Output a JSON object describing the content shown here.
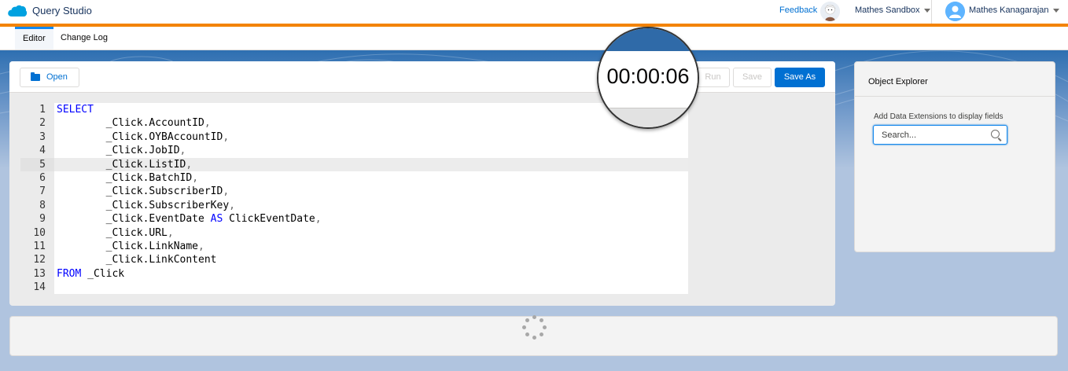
{
  "header": {
    "app_title": "Query Studio",
    "feedback_label": "Feedback",
    "org_name": "Mathes Sandbox",
    "user_name": "Mathes Kanagarajan",
    "accent_color": "#f38303",
    "logo_icon": "salesforce-cloud-icon"
  },
  "tabs": [
    {
      "label": "Editor",
      "active": true
    },
    {
      "label": "Change Log",
      "active": false
    }
  ],
  "toolbar": {
    "open_label": "Open",
    "run_label": "Run",
    "save_label": "Save",
    "save_as_label": "Save As",
    "timer": "00:00:06"
  },
  "editor": {
    "current_line": 5,
    "lines": [
      {
        "n": "1",
        "text": "SELECT"
      },
      {
        "n": "2",
        "text": "        _Click.AccountID,"
      },
      {
        "n": "3",
        "text": "        _Click.OYBAccountID,"
      },
      {
        "n": "4",
        "text": "        _Click.JobID,"
      },
      {
        "n": "5",
        "text": "        _Click.ListID,"
      },
      {
        "n": "6",
        "text": "        _Click.BatchID,"
      },
      {
        "n": "7",
        "text": "        _Click.SubscriberID,"
      },
      {
        "n": "8",
        "text": "        _Click.SubscriberKey,"
      },
      {
        "n": "9",
        "text": "        _Click.EventDate AS ClickEventDate,"
      },
      {
        "n": "10",
        "text": "        _Click.URL,"
      },
      {
        "n": "11",
        "text": "        _Click.LinkName,"
      },
      {
        "n": "12",
        "text": "        _Click.LinkContent"
      },
      {
        "n": "13",
        "text": "FROM _Click"
      },
      {
        "n": "14",
        "text": ""
      }
    ]
  },
  "explorer": {
    "title": "Object Explorer",
    "label": "Add Data Extensions to display fields",
    "search_placeholder": "Search..."
  }
}
